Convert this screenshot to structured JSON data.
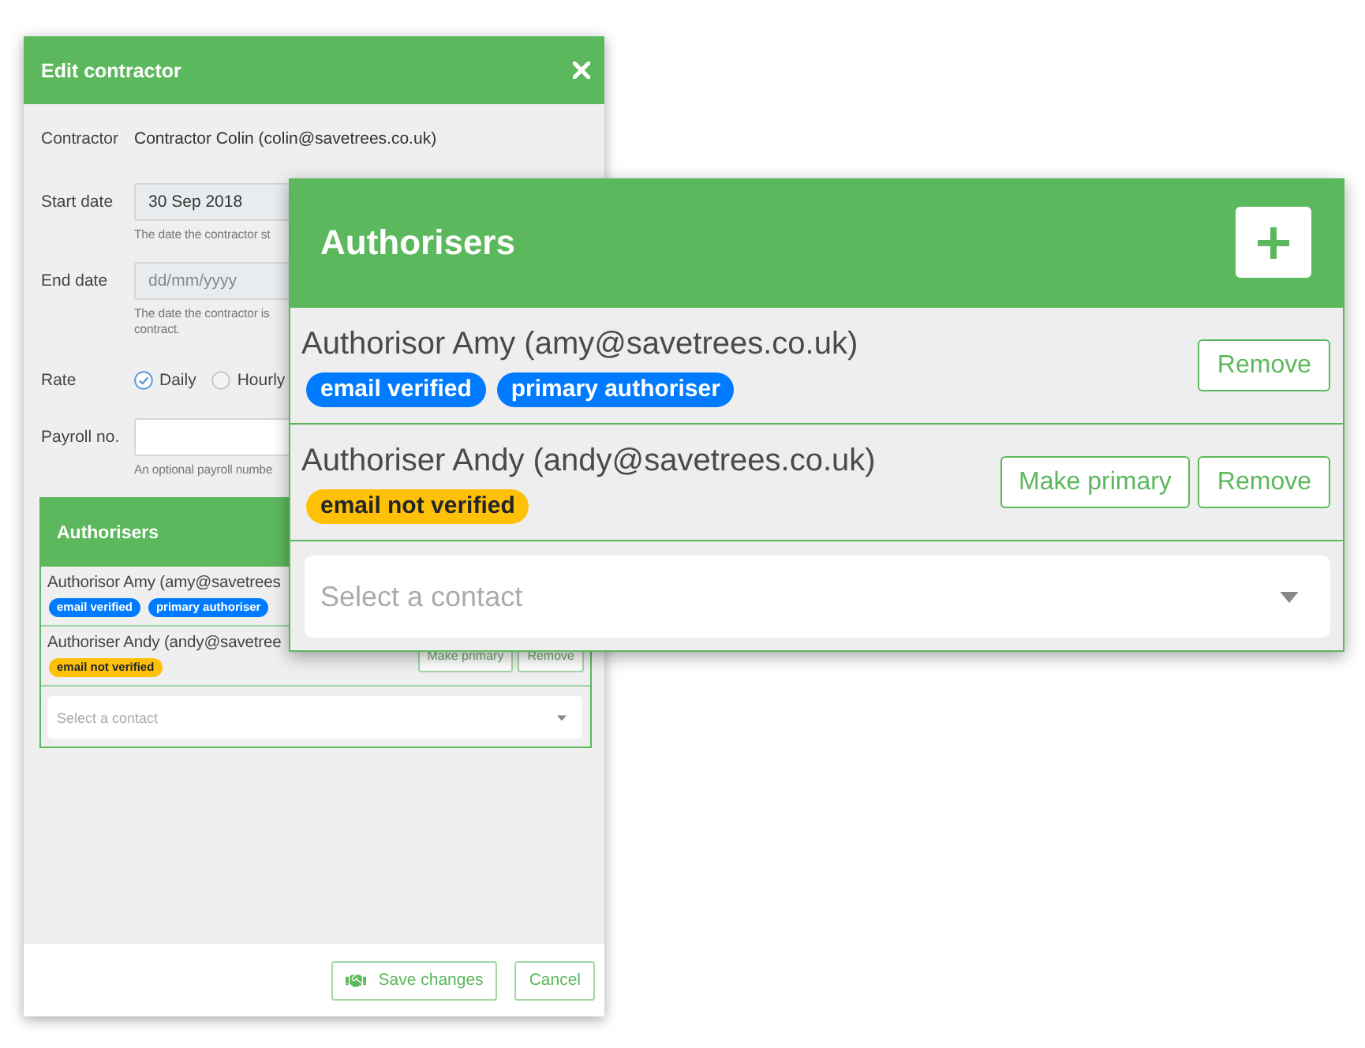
{
  "dialog": {
    "title": "Edit contractor",
    "fields": [
      {
        "kind": "static",
        "label": "Contractor",
        "value": "Contractor Colin (colin@savetrees.co.uk)"
      },
      {
        "kind": "date",
        "label": "Start date",
        "value": "30 Sep 2018",
        "hint": [
          "The date the contractor st"
        ]
      },
      {
        "kind": "date",
        "label": "End date",
        "placeholder": "dd/mm/yyyy",
        "hint": [
          "The date the contractor is",
          "contract."
        ]
      },
      {
        "kind": "radio",
        "label": "Rate",
        "options": [
          {
            "label": "Daily",
            "selected": true
          },
          {
            "label": "Hourly",
            "selected": false
          }
        ]
      },
      {
        "kind": "text",
        "label": "Payroll no.",
        "hint": [
          "An optional payroll numbe"
        ]
      }
    ],
    "authorisers": {
      "title": "Authorisers",
      "rows": [
        {
          "name": "Authorisor Amy (amy@savetrees",
          "badges": [
            {
              "label": "email verified",
              "color": "#007bff"
            },
            {
              "label": "primary authoriser",
              "color": "#007bff"
            }
          ]
        },
        {
          "name": "Authoriser Andy (andy@savetree",
          "badges": [
            {
              "label": "email not verified",
              "color": "#ffc107"
            }
          ],
          "actions": [
            "Make primary",
            "Remove"
          ]
        }
      ],
      "select": {
        "placeholder": "Select a contact"
      }
    },
    "buttons": [
      {
        "kind": "save",
        "label": "Save changes"
      },
      {
        "kind": "cancel",
        "label": "Cancel"
      }
    ]
  },
  "zoomed_authorisers": {
    "title": "Authorisers",
    "rows": [
      {
        "name": "Authorisor Amy (amy@savetrees.co.uk)",
        "badges": [
          {
            "label": "email verified",
            "color": "#007bff"
          },
          {
            "label": "primary authoriser",
            "color": "#007bff"
          }
        ],
        "actions": [
          "Remove"
        ]
      },
      {
        "name": "Authoriser Andy (andy@savetrees.co.uk)",
        "badges": [
          {
            "label": "email not verified",
            "color": "#ffc107"
          }
        ],
        "actions": [
          "Make primary",
          "Remove"
        ]
      }
    ],
    "select": {
      "placeholder": "Select a contact"
    }
  }
}
